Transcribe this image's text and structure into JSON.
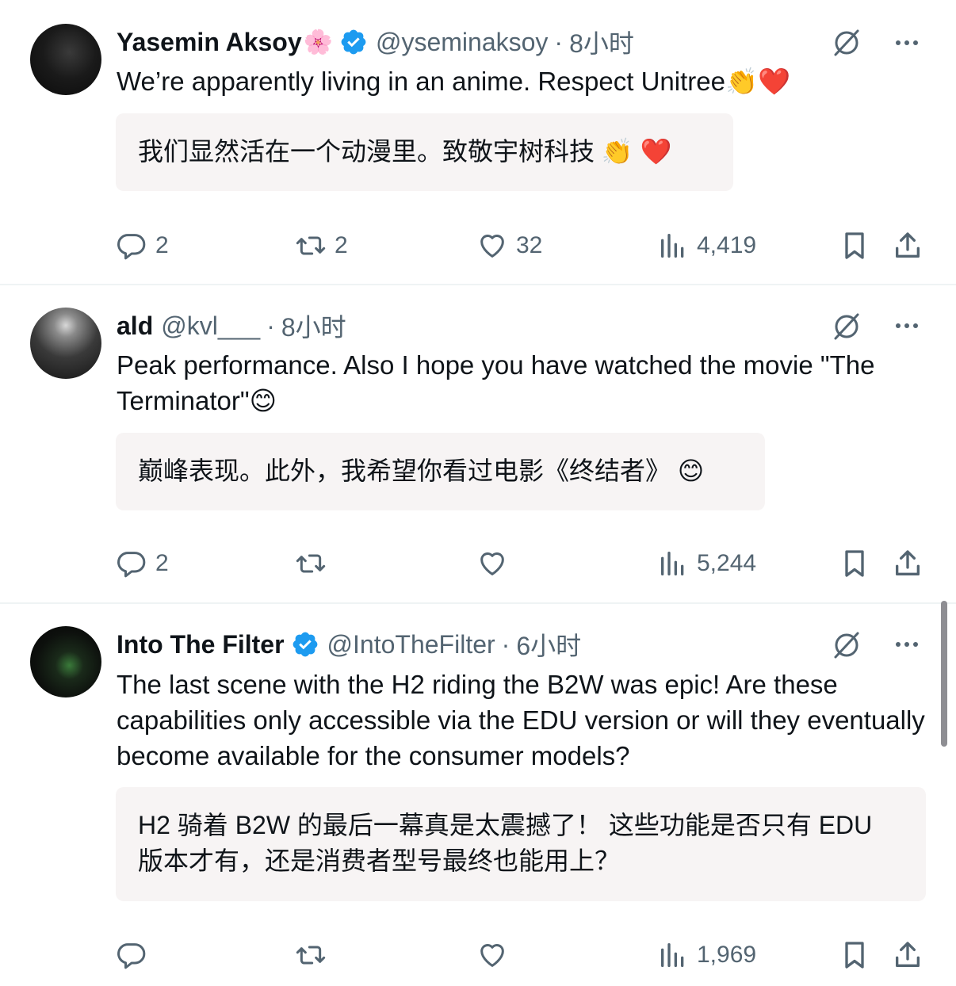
{
  "colors": {
    "text": "#0f1419",
    "secondary": "#536471",
    "verified": "#1d9bf0",
    "translation_bg": "#f7f4f4",
    "divider": "#eff3f4"
  },
  "icons": {
    "reply": "reply-icon",
    "retweet": "retweet-icon",
    "like": "heart-icon",
    "views": "views-icon",
    "bookmark": "bookmark-icon",
    "share": "share-icon",
    "grok": "grok-icon",
    "more": "more-icon",
    "verified": "verified-badge-icon"
  },
  "tweets": [
    {
      "name": "Yasemin Aksoy",
      "name_emoji": "🌸",
      "verified": true,
      "handle": "@yseminaksoy",
      "separator": "·",
      "time": "8小时",
      "text": "We’re apparently living in an anime. Respect Unitree👏❤️",
      "translation": "我们显然活在一个动漫里。致敬宇树科技 👏 ❤️",
      "replies": "2",
      "retweets": "2",
      "likes": "32",
      "views": "4,419"
    },
    {
      "name": "ald",
      "verified": false,
      "handle": "@kvl___",
      "separator": "·",
      "time": "8小时",
      "text": "Peak performance. Also I hope you have watched the movie \"The Terminator\"😊",
      "translation": "巅峰表现。此外，我希望你看过电影《终结者》 😊",
      "replies": "2",
      "retweets": "",
      "likes": "",
      "views": "5,244"
    },
    {
      "name": "Into The Filter",
      "verified": true,
      "handle": "@IntoTheFilter",
      "separator": "·",
      "time": "6小时",
      "text": "The last scene with the H2 riding the B2W was epic!  Are these capabilities only accessible via the EDU version or will they eventually become available for the consumer models?",
      "translation": "H2 骑着 B2W 的最后一幕真是太震撼了！ 这些功能是否只有 EDU 版本才有，还是消费者型号最终也能用上？",
      "replies": "",
      "retweets": "",
      "likes": "",
      "views": "1,969"
    }
  ]
}
